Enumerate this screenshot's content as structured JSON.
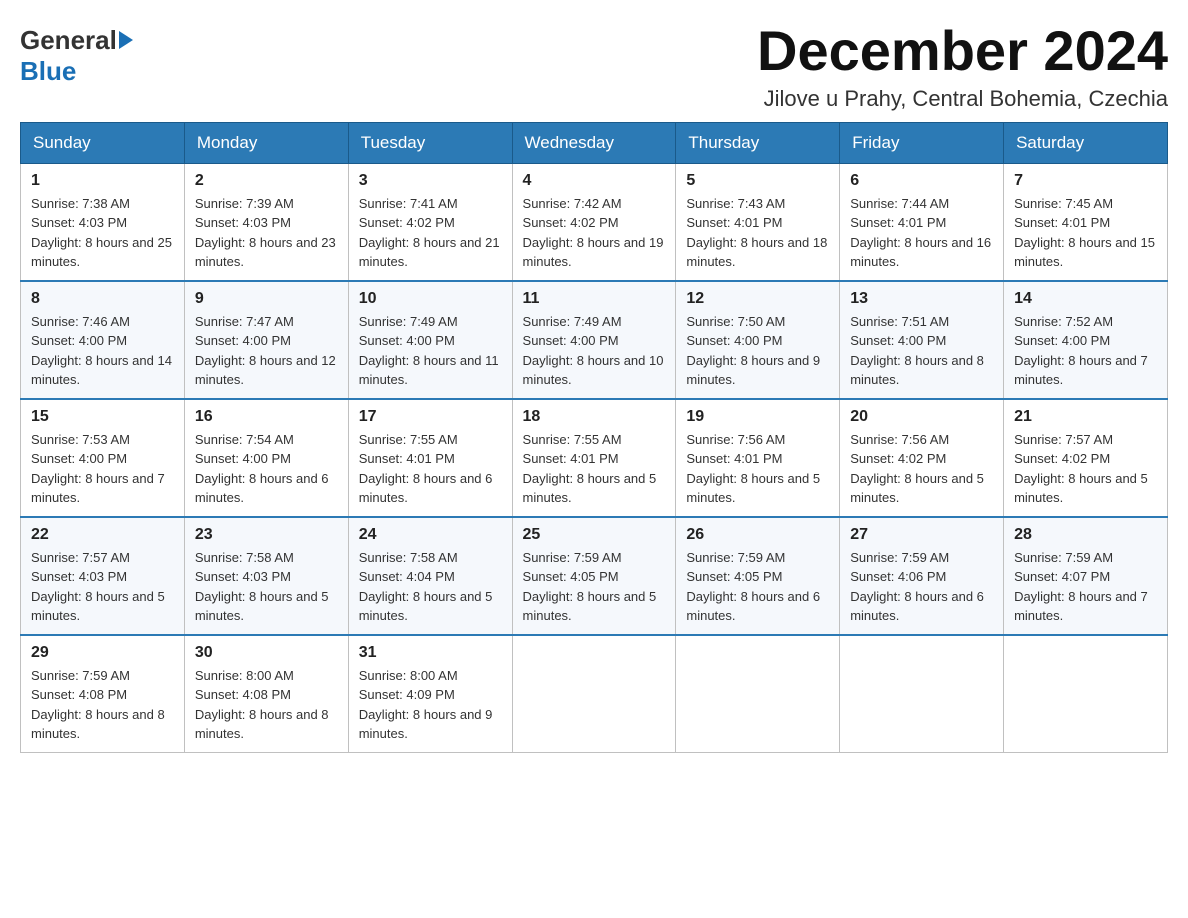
{
  "header": {
    "logo_text_general": "General",
    "logo_text_blue": "Blue",
    "month_title": "December 2024",
    "location": "Jilove u Prahy, Central Bohemia, Czechia"
  },
  "weekdays": [
    "Sunday",
    "Monday",
    "Tuesday",
    "Wednesday",
    "Thursday",
    "Friday",
    "Saturday"
  ],
  "weeks": [
    [
      {
        "day": "1",
        "sunrise": "7:38 AM",
        "sunset": "4:03 PM",
        "daylight": "8 hours and 25 minutes."
      },
      {
        "day": "2",
        "sunrise": "7:39 AM",
        "sunset": "4:03 PM",
        "daylight": "8 hours and 23 minutes."
      },
      {
        "day": "3",
        "sunrise": "7:41 AM",
        "sunset": "4:02 PM",
        "daylight": "8 hours and 21 minutes."
      },
      {
        "day": "4",
        "sunrise": "7:42 AM",
        "sunset": "4:02 PM",
        "daylight": "8 hours and 19 minutes."
      },
      {
        "day": "5",
        "sunrise": "7:43 AM",
        "sunset": "4:01 PM",
        "daylight": "8 hours and 18 minutes."
      },
      {
        "day": "6",
        "sunrise": "7:44 AM",
        "sunset": "4:01 PM",
        "daylight": "8 hours and 16 minutes."
      },
      {
        "day": "7",
        "sunrise": "7:45 AM",
        "sunset": "4:01 PM",
        "daylight": "8 hours and 15 minutes."
      }
    ],
    [
      {
        "day": "8",
        "sunrise": "7:46 AM",
        "sunset": "4:00 PM",
        "daylight": "8 hours and 14 minutes."
      },
      {
        "day": "9",
        "sunrise": "7:47 AM",
        "sunset": "4:00 PM",
        "daylight": "8 hours and 12 minutes."
      },
      {
        "day": "10",
        "sunrise": "7:49 AM",
        "sunset": "4:00 PM",
        "daylight": "8 hours and 11 minutes."
      },
      {
        "day": "11",
        "sunrise": "7:49 AM",
        "sunset": "4:00 PM",
        "daylight": "8 hours and 10 minutes."
      },
      {
        "day": "12",
        "sunrise": "7:50 AM",
        "sunset": "4:00 PM",
        "daylight": "8 hours and 9 minutes."
      },
      {
        "day": "13",
        "sunrise": "7:51 AM",
        "sunset": "4:00 PM",
        "daylight": "8 hours and 8 minutes."
      },
      {
        "day": "14",
        "sunrise": "7:52 AM",
        "sunset": "4:00 PM",
        "daylight": "8 hours and 7 minutes."
      }
    ],
    [
      {
        "day": "15",
        "sunrise": "7:53 AM",
        "sunset": "4:00 PM",
        "daylight": "8 hours and 7 minutes."
      },
      {
        "day": "16",
        "sunrise": "7:54 AM",
        "sunset": "4:00 PM",
        "daylight": "8 hours and 6 minutes."
      },
      {
        "day": "17",
        "sunrise": "7:55 AM",
        "sunset": "4:01 PM",
        "daylight": "8 hours and 6 minutes."
      },
      {
        "day": "18",
        "sunrise": "7:55 AM",
        "sunset": "4:01 PM",
        "daylight": "8 hours and 5 minutes."
      },
      {
        "day": "19",
        "sunrise": "7:56 AM",
        "sunset": "4:01 PM",
        "daylight": "8 hours and 5 minutes."
      },
      {
        "day": "20",
        "sunrise": "7:56 AM",
        "sunset": "4:02 PM",
        "daylight": "8 hours and 5 minutes."
      },
      {
        "day": "21",
        "sunrise": "7:57 AM",
        "sunset": "4:02 PM",
        "daylight": "8 hours and 5 minutes."
      }
    ],
    [
      {
        "day": "22",
        "sunrise": "7:57 AM",
        "sunset": "4:03 PM",
        "daylight": "8 hours and 5 minutes."
      },
      {
        "day": "23",
        "sunrise": "7:58 AM",
        "sunset": "4:03 PM",
        "daylight": "8 hours and 5 minutes."
      },
      {
        "day": "24",
        "sunrise": "7:58 AM",
        "sunset": "4:04 PM",
        "daylight": "8 hours and 5 minutes."
      },
      {
        "day": "25",
        "sunrise": "7:59 AM",
        "sunset": "4:05 PM",
        "daylight": "8 hours and 5 minutes."
      },
      {
        "day": "26",
        "sunrise": "7:59 AM",
        "sunset": "4:05 PM",
        "daylight": "8 hours and 6 minutes."
      },
      {
        "day": "27",
        "sunrise": "7:59 AM",
        "sunset": "4:06 PM",
        "daylight": "8 hours and 6 minutes."
      },
      {
        "day": "28",
        "sunrise": "7:59 AM",
        "sunset": "4:07 PM",
        "daylight": "8 hours and 7 minutes."
      }
    ],
    [
      {
        "day": "29",
        "sunrise": "7:59 AM",
        "sunset": "4:08 PM",
        "daylight": "8 hours and 8 minutes."
      },
      {
        "day": "30",
        "sunrise": "8:00 AM",
        "sunset": "4:08 PM",
        "daylight": "8 hours and 8 minutes."
      },
      {
        "day": "31",
        "sunrise": "8:00 AM",
        "sunset": "4:09 PM",
        "daylight": "8 hours and 9 minutes."
      },
      null,
      null,
      null,
      null
    ]
  ]
}
